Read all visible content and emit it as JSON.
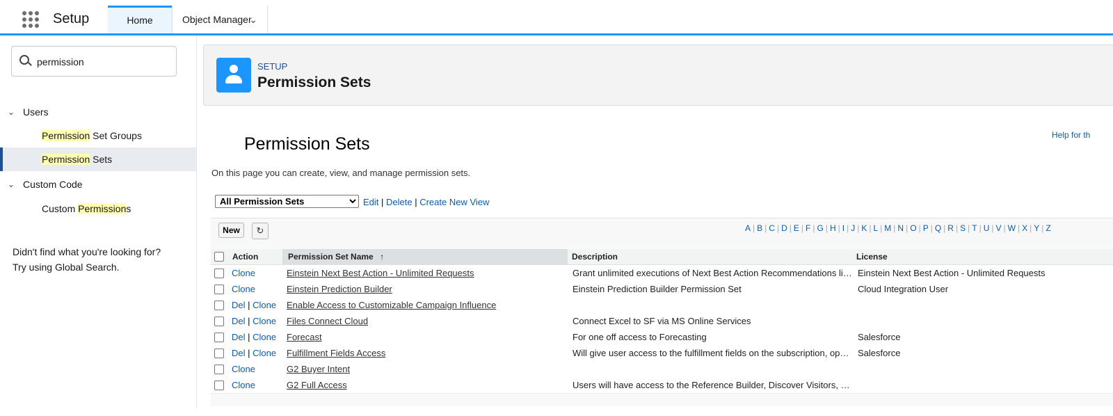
{
  "nav": {
    "app_name": "Setup",
    "tabs": [
      {
        "label": "Home"
      },
      {
        "label": "Object Manager"
      }
    ]
  },
  "sidebar": {
    "search_value": "permission",
    "groups": [
      {
        "label": "Users",
        "items": [
          {
            "highlight": "Permission",
            "rest": " Set Groups"
          },
          {
            "highlight": "Permission",
            "rest": " Sets",
            "active": true
          }
        ]
      },
      {
        "label": "Custom Code",
        "items": [
          {
            "prefix": "Custom ",
            "highlight": "Permission",
            "rest": "s"
          }
        ]
      }
    ],
    "not_found_line1": "Didn't find what you're looking for?",
    "not_found_line2": "Try using Global Search."
  },
  "header": {
    "eyebrow": "SETUP",
    "title": "Permission Sets"
  },
  "main": {
    "help_link": "Help for th",
    "title": "Permission Sets",
    "intro": "On this page you can create, view, and manage permission sets.",
    "view_selected": "All Permission Sets",
    "view_links": {
      "edit": "Edit",
      "delete": "Delete",
      "create": "Create New View",
      "sep": " | "
    },
    "new_button": "New",
    "alphabet": [
      "A",
      "B",
      "C",
      "D",
      "E",
      "F",
      "G",
      "H",
      "I",
      "J",
      "K",
      "L",
      "M",
      "N",
      "O",
      "P",
      "Q",
      "R",
      "S",
      "T",
      "U",
      "V",
      "W",
      "X",
      "Y",
      "Z"
    ],
    "columns": {
      "action": "Action",
      "name": "Permission Set Name",
      "sort_glyph": "↑",
      "description": "Description",
      "license": "License"
    },
    "action_labels": {
      "del": "Del",
      "clone": "Clone",
      "sep": " | "
    },
    "rows": [
      {
        "del": false,
        "name": "Einstein Next Best Action - Unlimited Requests",
        "description": "Grant unlimited executions of Next Best Action Recommendations lice…",
        "license": "Einstein Next Best Action - Unlimited Requests"
      },
      {
        "del": false,
        "name": "Einstein Prediction Builder",
        "description": "Einstein Prediction Builder Permission Set",
        "license": "Cloud Integration User"
      },
      {
        "del": true,
        "name": "Enable Access to Customizable Campaign Influence",
        "description": "",
        "license": ""
      },
      {
        "del": true,
        "name": "Files Connect Cloud",
        "description": "Connect Excel to SF via MS Online Services",
        "license": ""
      },
      {
        "del": true,
        "name": "Forecast",
        "description": "For one off access to Forecasting",
        "license": "Salesforce"
      },
      {
        "del": true,
        "name": "Fulfillment Fields Access",
        "description": "Will give user access to the fulfillment fields on the subscription, opp li…",
        "license": "Salesforce"
      },
      {
        "del": false,
        "name": "G2 Buyer Intent",
        "description": "",
        "license": ""
      },
      {
        "del": false,
        "name": "G2 Full Access",
        "description": "Users will have access to the Reference Builder, Discover Visitors, an…",
        "license": ""
      }
    ]
  },
  "icons": {
    "chevron": "⌄",
    "refresh": "↻"
  }
}
